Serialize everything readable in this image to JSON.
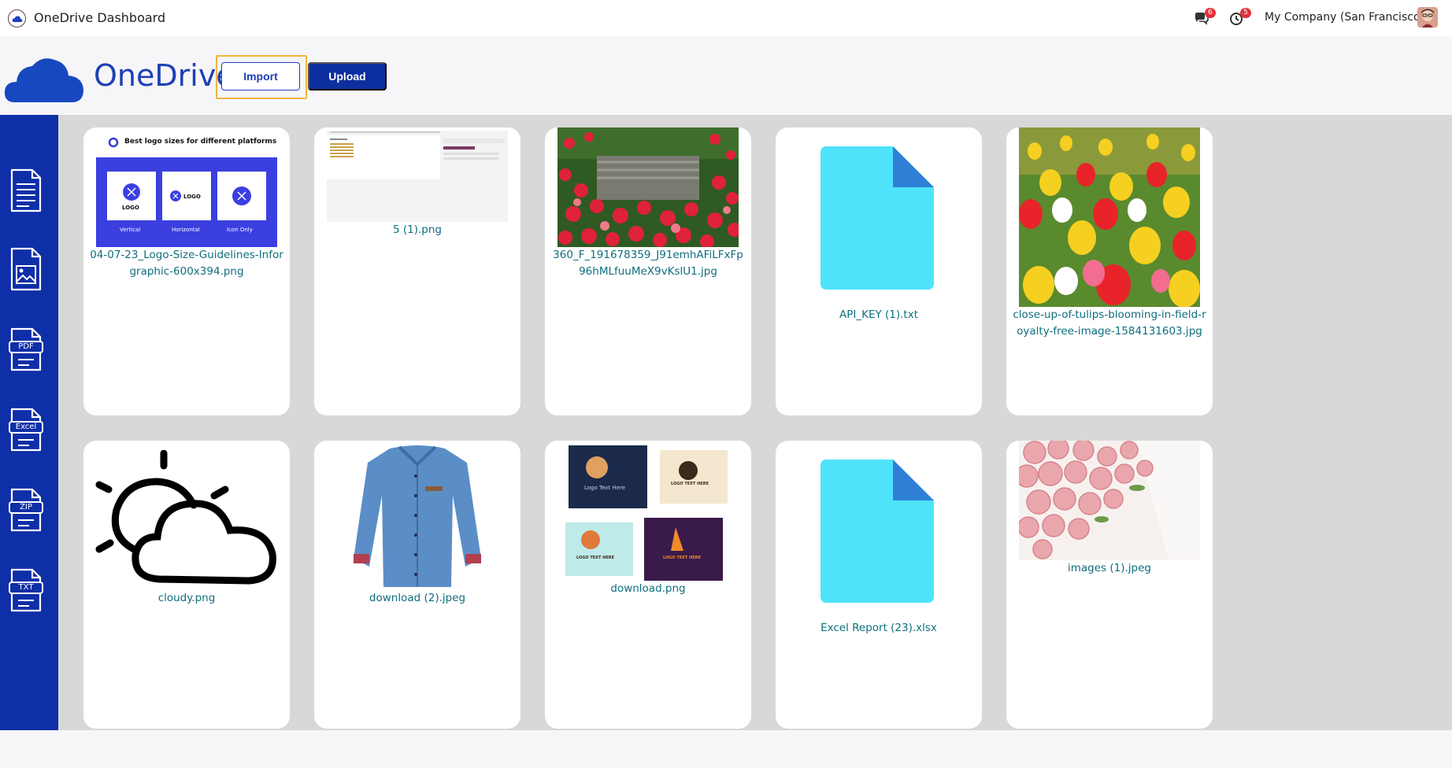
{
  "topbar": {
    "title": "OneDrive Dashboard",
    "messages_count": "6",
    "activities_count": "5",
    "company": "My Company (San Francisco)"
  },
  "header": {
    "brand": "OneDrive",
    "import_label": "Import",
    "upload_label": "Upload"
  },
  "sidebar": {
    "items": [
      {
        "name": "document",
        "label": ""
      },
      {
        "name": "image",
        "label": ""
      },
      {
        "name": "pdf",
        "label": "PDF"
      },
      {
        "name": "excel",
        "label": "Excel"
      },
      {
        "name": "zip",
        "label": "ZIP"
      },
      {
        "name": "txt",
        "label": "TXT"
      }
    ]
  },
  "files": [
    {
      "name": "04-07-23_Logo-Size-Guidelines-Inforgraphic-600x394.png",
      "kind": "logo-guide"
    },
    {
      "name": "5 (1).png",
      "kind": "screenshot"
    },
    {
      "name": "360_F_191678359_J91emhAFiLFxFp96hMLfuuMeX9vKslU1.jpg",
      "kind": "roses-bench"
    },
    {
      "name": "API_KEY (1).txt",
      "kind": "generic-file"
    },
    {
      "name": "close-up-of-tulips-blooming-in-field-royalty-free-image-1584131603.jpg",
      "kind": "tulips"
    },
    {
      "name": "cloudy.png",
      "kind": "cloudy"
    },
    {
      "name": "download (2).jpeg",
      "kind": "shirt"
    },
    {
      "name": "download.png",
      "kind": "logos"
    },
    {
      "name": "Excel Report (23).xlsx",
      "kind": "generic-file"
    },
    {
      "name": "images (1).jpeg",
      "kind": "pink-roses"
    }
  ],
  "logo_guide": {
    "title": "Best logo sizes for different platforms",
    "labels": [
      "Vertical",
      "Horizontal",
      "Icon Only"
    ],
    "logo_text": "LOGO"
  },
  "logos_thumb": {
    "texts": [
      "Logo Text Here",
      "LOGO TEXT HERE",
      "LOGO TEXT HERE",
      "LOGO TEXT HERE"
    ]
  },
  "colors": {
    "brand_blue": "#0f2fa8",
    "filename_teal": "#0e6e7e",
    "file_icon_cyan": "#4fe3fb",
    "file_icon_fold": "#2f7fd6",
    "focus_ring": "#f2b542"
  }
}
